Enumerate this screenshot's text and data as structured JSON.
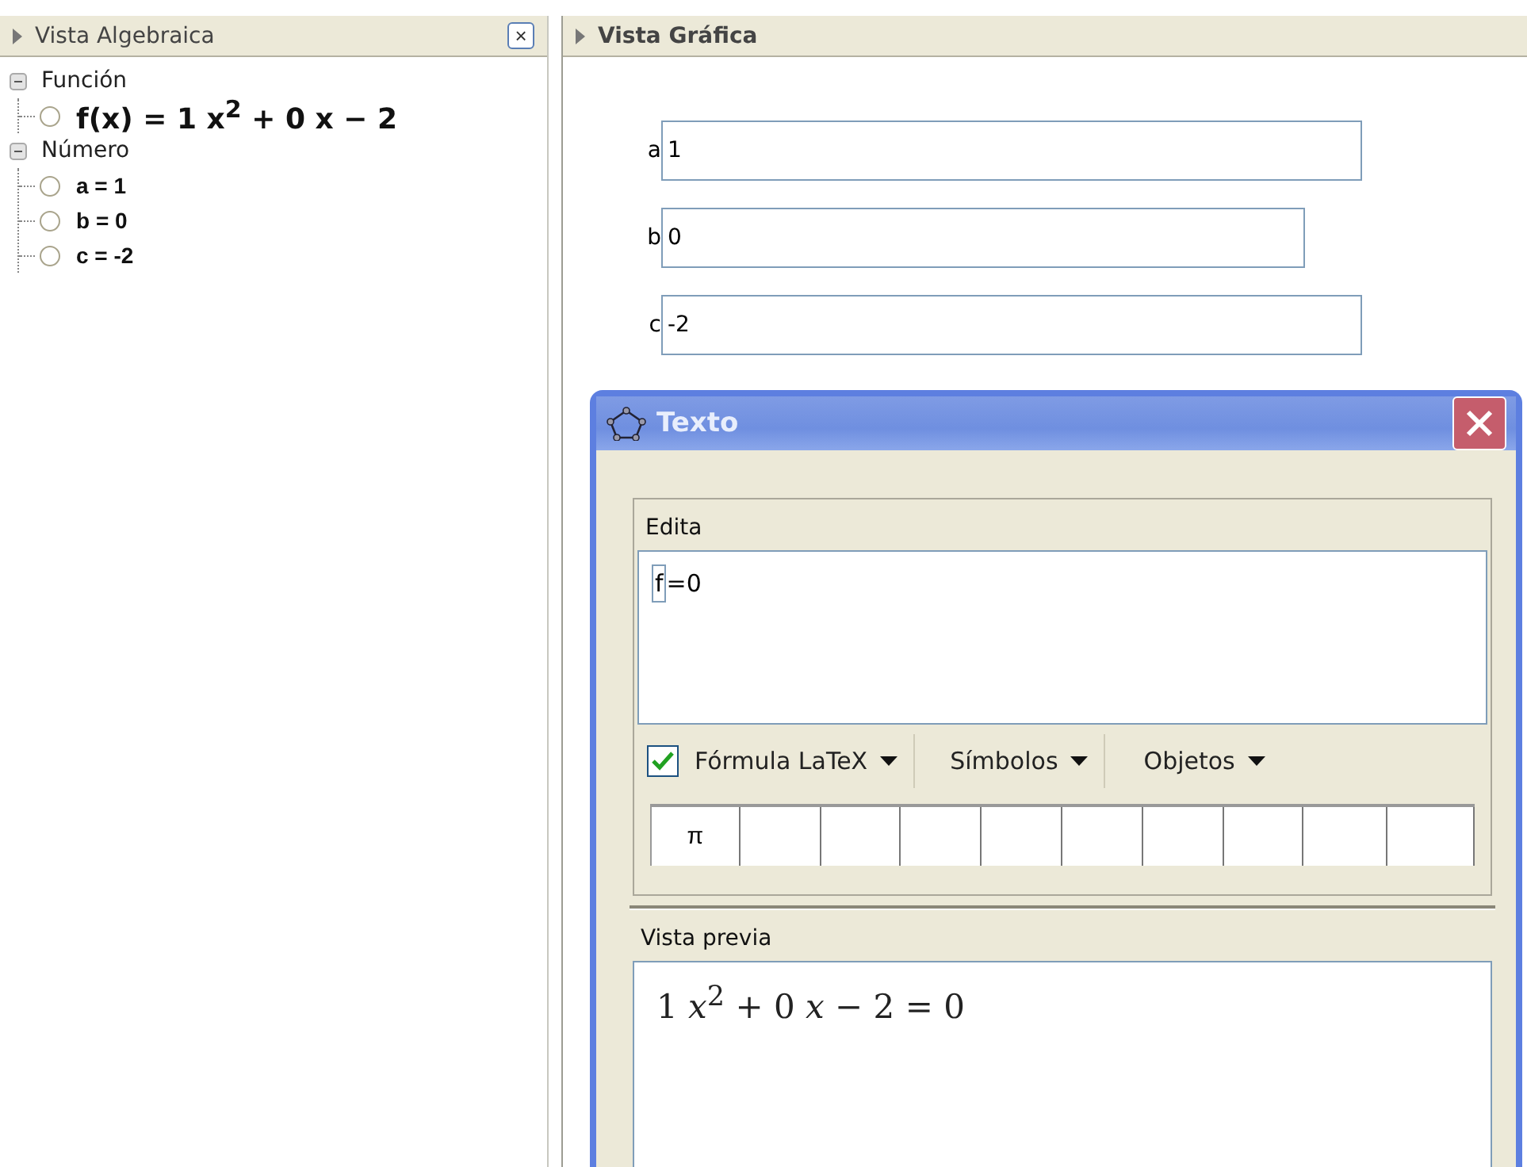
{
  "algebra_view": {
    "title": "Vista Algebraica",
    "close": "×",
    "categories": [
      {
        "label": "Función",
        "expanded": true,
        "children": [
          {
            "label": "f(x) = 1 x$^{2}$ + 0 x − 2",
            "shown": false,
            "kind": "formula"
          }
        ]
      },
      {
        "label": "Número",
        "expanded": true,
        "children": [
          {
            "label": "a = 1",
            "shown": false,
            "kind": "plain"
          },
          {
            "label": "b = 0",
            "shown": false,
            "kind": "plain"
          },
          {
            "label": "c = -2",
            "shown": false,
            "kind": "plain"
          }
        ]
      }
    ]
  },
  "graphics_view": {
    "title": "Vista Gráfica",
    "inputs": [
      {
        "label": "a",
        "value": "1"
      },
      {
        "label": "b",
        "value": "0"
      },
      {
        "label": "c",
        "value": "-2"
      }
    ]
  },
  "dialog": {
    "title": "Texto",
    "edit_label": "Edita",
    "editor": {
      "token": "f",
      "rest": "=0"
    },
    "latex": {
      "label": "Fórmula LaTeX",
      "checked": true
    },
    "menus": [
      "Símbolos",
      "Objetos"
    ],
    "symbols": [
      "π"
    ],
    "preview_label": "Vista previa",
    "preview": "1 *x*$^{2}$ + 0 *x* − 2 = 0"
  }
}
